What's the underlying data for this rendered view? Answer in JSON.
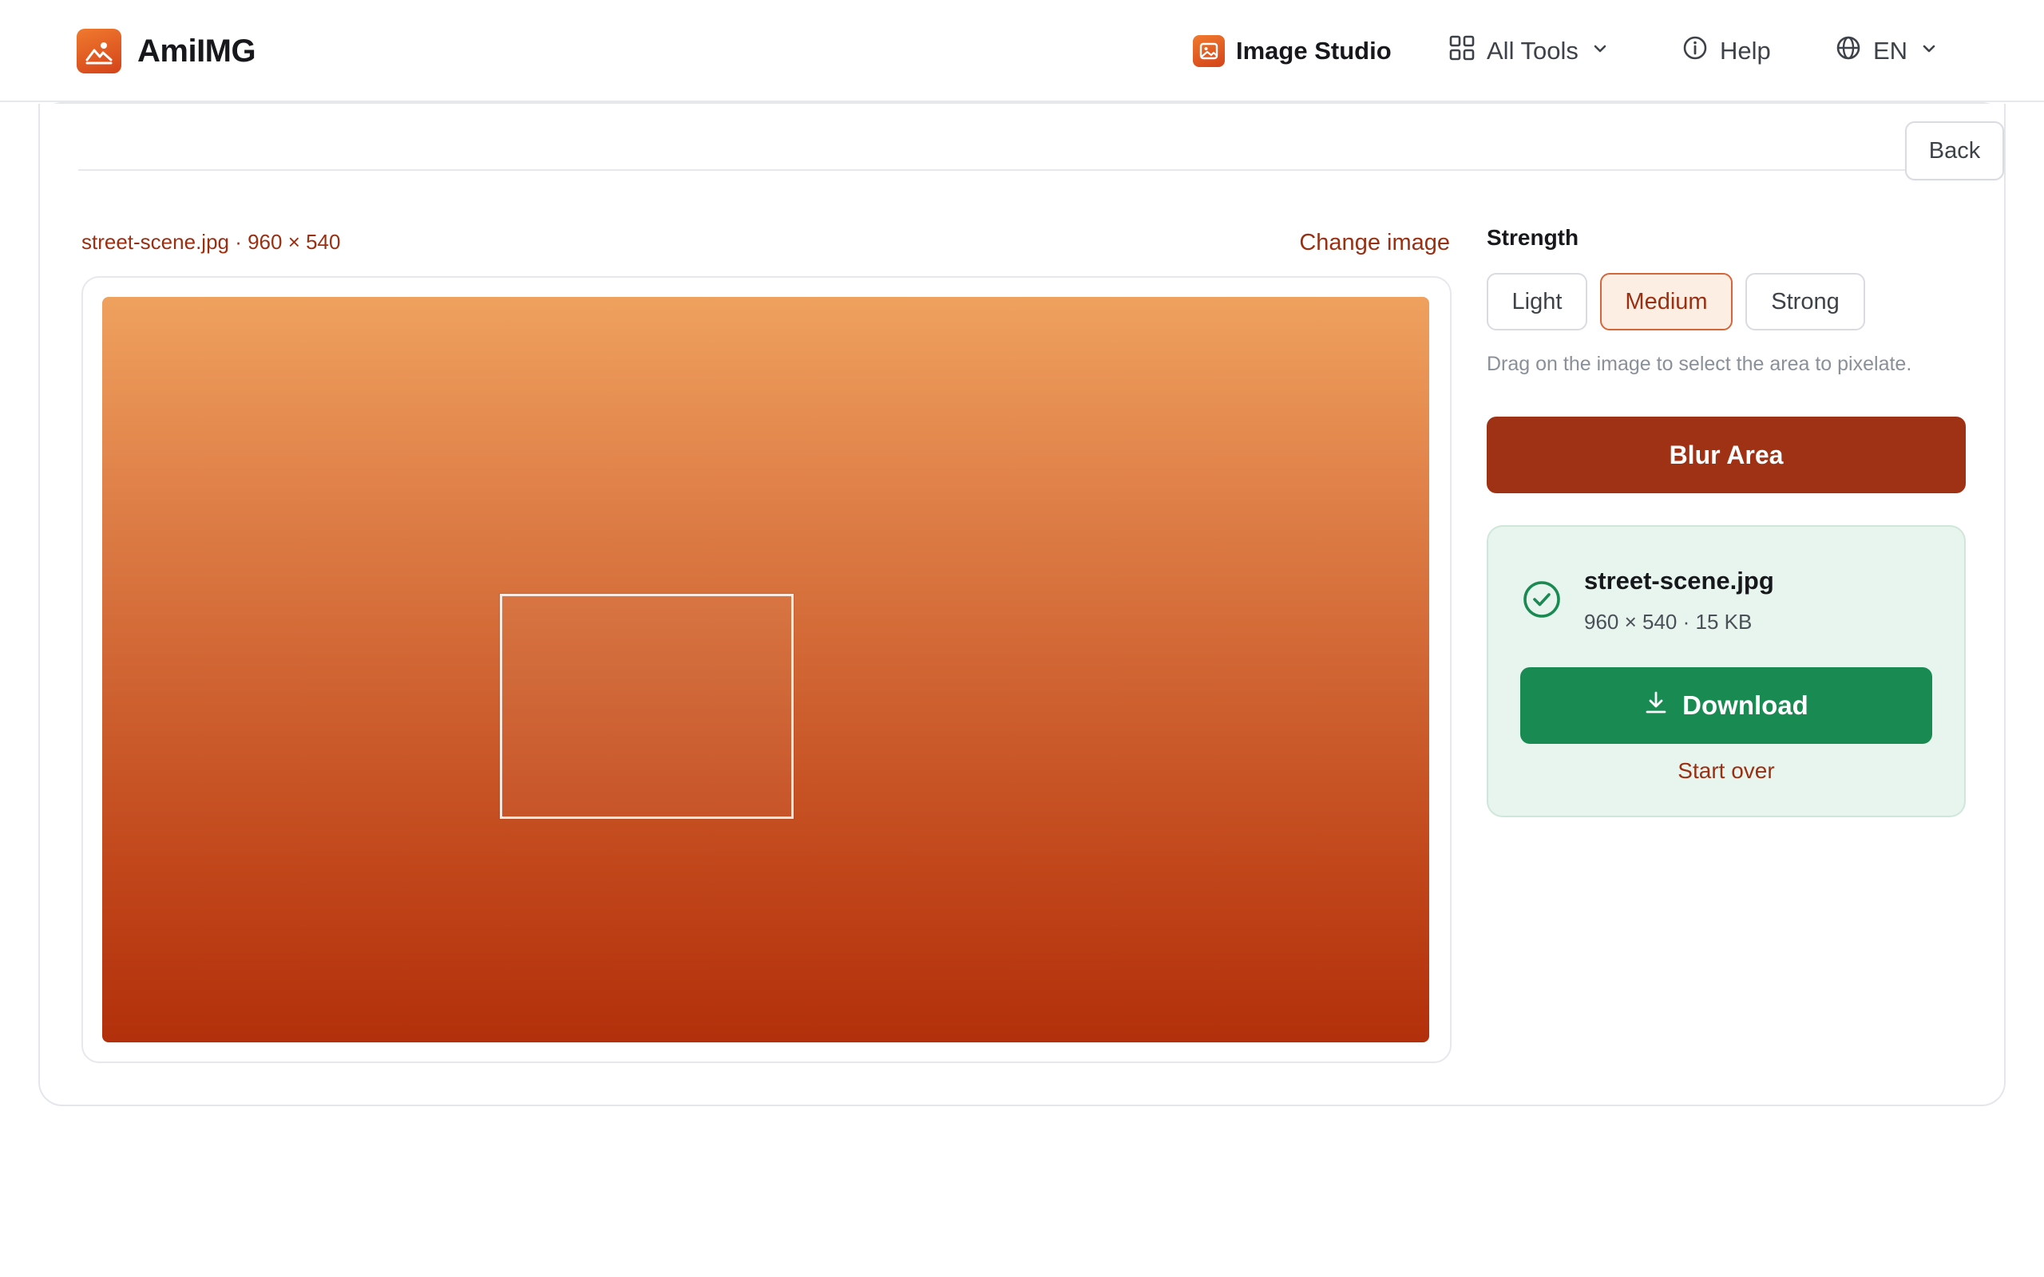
{
  "app": {
    "name": "AmiIMG"
  },
  "nav": {
    "studio": "Image Studio",
    "tools": "All Tools",
    "help": "Help",
    "lang": "EN"
  },
  "editor": {
    "back_label": "Back",
    "file_meta": "street-scene.jpg · 960 × 540",
    "change_image": "Change image"
  },
  "panel": {
    "strength_title": "Strength",
    "options": [
      "Light",
      "Medium",
      "Strong"
    ],
    "selected_option": "Medium",
    "hint": "Drag on the image to select the area to pixelate.",
    "blur_button": "Blur Area"
  },
  "result": {
    "filename": "street-scene.jpg",
    "meta": "960 × 540 · 15 KB",
    "download": "Download",
    "start_over": "Start over"
  },
  "colors": {
    "brand": "#e05a24",
    "primary_action": "#9f3214",
    "success": "#198a52",
    "success_bg": "#e8f5ee",
    "link": "#9a2f12"
  },
  "icons": [
    "logo-icon",
    "image-studio-icon",
    "grid-icon",
    "chevron-down-icon",
    "info-icon",
    "globe-icon",
    "check-circle-icon",
    "download-icon"
  ]
}
